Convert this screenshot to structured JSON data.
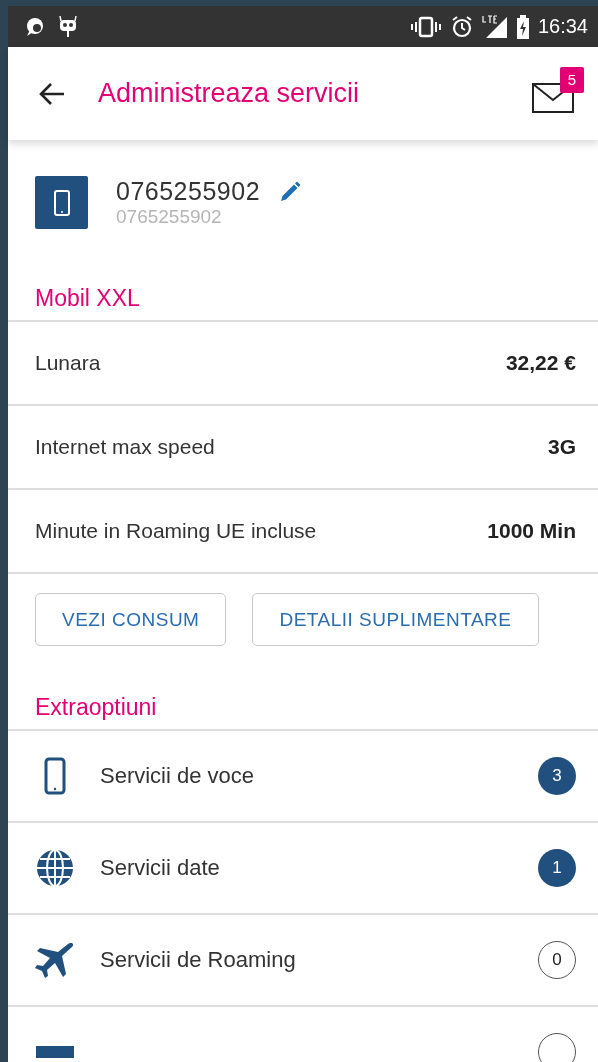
{
  "status_bar": {
    "time": "16:34"
  },
  "header": {
    "title": "Administreaza servicii",
    "mail_count": "5"
  },
  "account": {
    "number": "0765255902",
    "subtitle": "0765255902"
  },
  "plan": {
    "title": "Mobil XXL",
    "rows": [
      {
        "label": "Lunara",
        "value": "32,22 €"
      },
      {
        "label": "Internet max speed",
        "value": "3G"
      },
      {
        "label": "Minute in Roaming UE incluse",
        "value": "1000 Min"
      }
    ],
    "buttons": [
      "VEZI CONSUM",
      "DETALII SUPLIMENTARE"
    ]
  },
  "extras": {
    "title": "Extraoptiuni",
    "items": [
      {
        "kind": "phone",
        "label": "Servicii de voce",
        "count": "3",
        "active": true
      },
      {
        "kind": "globe",
        "label": "Servicii date",
        "count": "1",
        "active": true
      },
      {
        "kind": "plane",
        "label": "Servicii de Roaming",
        "count": "0",
        "active": false
      },
      {
        "kind": "block",
        "active": false
      }
    ]
  }
}
